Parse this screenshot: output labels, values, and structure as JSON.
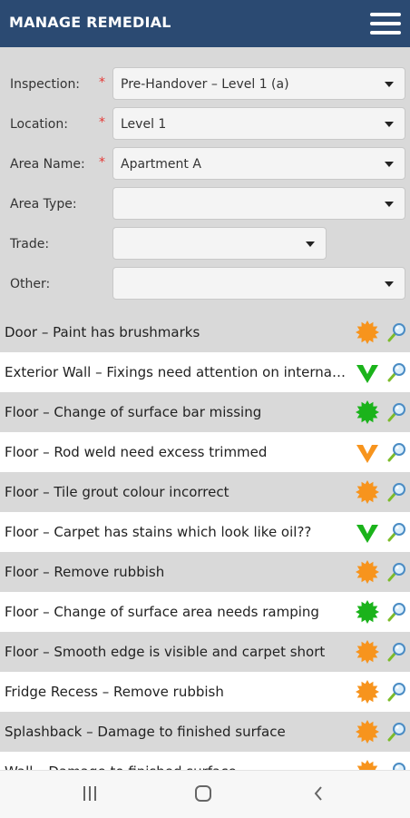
{
  "header": {
    "title": "MANAGE REMEDIAL"
  },
  "filters": [
    {
      "label": "Inspection:",
      "required": true,
      "value": "Pre-Handover – Level 1 (a)"
    },
    {
      "label": "Location:",
      "required": true,
      "value": "Level 1"
    },
    {
      "label": "Area Name:",
      "required": true,
      "value": "Apartment A"
    },
    {
      "label": "Area Type:",
      "required": false,
      "value": ""
    },
    {
      "label": "Trade:",
      "required": false,
      "value": ""
    },
    {
      "label": "Other:",
      "required": false,
      "value": ""
    }
  ],
  "required_marker": "*",
  "items": [
    {
      "text": "Door – Paint has brushmarks",
      "status": "orange-starburst"
    },
    {
      "text": "Exterior Wall – Fixings need attention on internal wall",
      "status": "green-chevron"
    },
    {
      "text": "Floor – Change of surface bar missing",
      "status": "green-starburst"
    },
    {
      "text": "Floor – Rod weld need excess trimmed",
      "status": "orange-chevron"
    },
    {
      "text": "Floor – Tile grout colour incorrect",
      "status": "orange-starburst"
    },
    {
      "text": "Floor – Carpet has stains which look like oil??",
      "status": "green-chevron"
    },
    {
      "text": "Floor – Remove rubbish",
      "status": "orange-starburst"
    },
    {
      "text": "Floor – Change of surface area needs ramping",
      "status": "green-starburst"
    },
    {
      "text": "Floor – Smooth edge is visible and carpet short",
      "status": "orange-starburst"
    },
    {
      "text": "Fridge Recess – Remove rubbish",
      "status": "orange-starburst"
    },
    {
      "text": "Splashback – Damage to finished surface",
      "status": "orange-starburst"
    },
    {
      "text": "Wall – Damage to finished surface",
      "status": "orange-starburst"
    }
  ],
  "colors": {
    "header": "#2b4a72",
    "orange": "#f7941d",
    "green": "#1bb31b",
    "row_grey": "#d9d9d9",
    "row_white": "#ffffff"
  },
  "icons": {
    "menu": "hamburger-menu-icon",
    "dropdown": "dropdown-arrow-icon",
    "view": "magnifier-icon",
    "nav_recent": "recent-apps-icon",
    "nav_home": "home-icon",
    "nav_back": "back-icon"
  }
}
